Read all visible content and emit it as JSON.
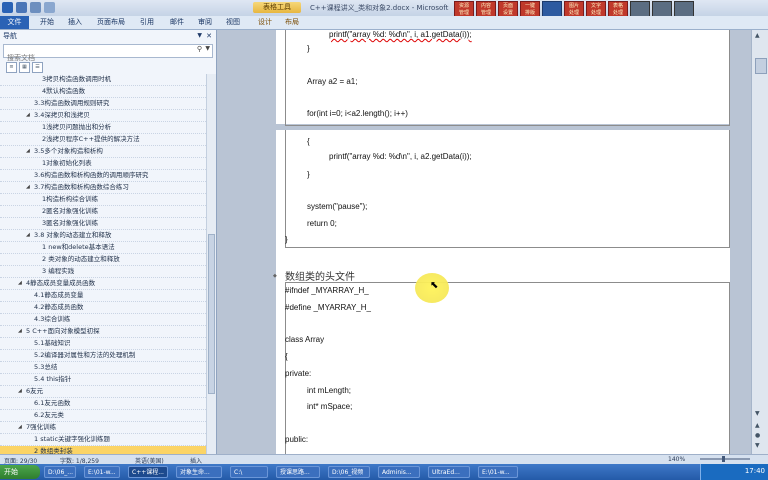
{
  "app": {
    "context_tab": "表格工具",
    "doc_title": "C++课程讲义_类和对象2.docx - Microsoft"
  },
  "ribbon_tabs": [
    "文件",
    "开始",
    "插入",
    "页面布局",
    "引用",
    "邮件",
    "审阅",
    "视图",
    "设计",
    "布局"
  ],
  "toolbar_icons": [
    {
      "label": "资源\n管理",
      "icon": "toolbar-icon-1"
    },
    {
      "label": "内容\n管理",
      "icon": "toolbar-icon-2"
    },
    {
      "label": "页面\n设置",
      "icon": "toolbar-icon-3"
    },
    {
      "label": "一键\n排版",
      "icon": "toolbar-icon-4"
    },
    {
      "label": "",
      "icon": "system-icon-1"
    },
    {
      "label": "图片\n处理",
      "icon": "toolbar-icon-5"
    },
    {
      "label": "文字\n处理",
      "icon": "toolbar-icon-6"
    },
    {
      "label": "表格\n处理",
      "icon": "toolbar-icon-7"
    },
    {
      "label": "",
      "icon": "system-icon-2"
    },
    {
      "label": "",
      "icon": "system-icon-3"
    },
    {
      "label": "",
      "icon": "system-icon-4"
    }
  ],
  "nav": {
    "title": "导航",
    "search_placeholder": "搜索文档",
    "items": [
      {
        "text": "3拷贝构造函数调用时机",
        "indent": 4,
        "toggle": ""
      },
      {
        "text": "4默认构造函数",
        "indent": 4,
        "toggle": ""
      },
      {
        "text": "3.3构造函数调用规则研究",
        "indent": 3,
        "toggle": ""
      },
      {
        "text": "3.4深拷贝和浅拷贝",
        "indent": 3,
        "toggle": "◢"
      },
      {
        "text": "1浅拷贝问题抛出和分析",
        "indent": 4,
        "toggle": ""
      },
      {
        "text": "2浅拷贝程序C++提供的解决方法",
        "indent": 4,
        "toggle": ""
      },
      {
        "text": "3.5多个对象构造和析构",
        "indent": 3,
        "toggle": "◢"
      },
      {
        "text": "1对象初始化列表",
        "indent": 4,
        "toggle": ""
      },
      {
        "text": "3.6构造函数和析构函数的调用顺序研究",
        "indent": 3,
        "toggle": ""
      },
      {
        "text": "3.7构造函数和析构函数综合练习",
        "indent": 3,
        "toggle": "◢"
      },
      {
        "text": "1构造析构综合训练",
        "indent": 4,
        "toggle": ""
      },
      {
        "text": "2匿名对象强化训练",
        "indent": 4,
        "toggle": ""
      },
      {
        "text": "3匿名对象强化训练",
        "indent": 4,
        "toggle": ""
      },
      {
        "text": "3.8 对象的动态建立和释放",
        "indent": 3,
        "toggle": "◢"
      },
      {
        "text": "1 new和delete基本语法",
        "indent": 4,
        "toggle": ""
      },
      {
        "text": "2 类对象的动态建立和释放",
        "indent": 4,
        "toggle": ""
      },
      {
        "text": "3 编程实践",
        "indent": 4,
        "toggle": ""
      },
      {
        "text": "4静态成员变量成员函数",
        "indent": 2,
        "toggle": "◢"
      },
      {
        "text": "4.1静态成员变量",
        "indent": 3,
        "toggle": ""
      },
      {
        "text": "4.2静态成员函数",
        "indent": 3,
        "toggle": ""
      },
      {
        "text": "4.3综合训练",
        "indent": 3,
        "toggle": ""
      },
      {
        "text": "5 C++面向对象模型初探",
        "indent": 2,
        "toggle": "◢"
      },
      {
        "text": "5.1基础知识",
        "indent": 3,
        "toggle": ""
      },
      {
        "text": "5.2编译器对属性和方法的处理机制",
        "indent": 3,
        "toggle": ""
      },
      {
        "text": "5.3总结",
        "indent": 3,
        "toggle": ""
      },
      {
        "text": "5.4 this指针",
        "indent": 3,
        "toggle": ""
      },
      {
        "text": "6友元",
        "indent": 2,
        "toggle": "◢"
      },
      {
        "text": "6.1友元函数",
        "indent": 3,
        "toggle": ""
      },
      {
        "text": "6.2友元类",
        "indent": 3,
        "toggle": ""
      },
      {
        "text": "7强化训练",
        "indent": 2,
        "toggle": "◢"
      },
      {
        "text": "1 static关键字强化训练题",
        "indent": 3,
        "toggle": ""
      },
      {
        "text": "2 数组类封装",
        "indent": 3,
        "toggle": "",
        "selected": true
      }
    ]
  },
  "document": {
    "page1_lines": [
      "printf(\"array %d: %d\\n\", i, a1.getData(i));",
      "}",
      "Array a2 = a1;",
      "for(int i=0; i<a2.length(); i++)"
    ],
    "page2_block1": [
      "{",
      "printf(\"array %d: %d\\n\", i, a2.getData(i));",
      "}",
      "system(\"pause\");",
      "return 0;",
      "}"
    ],
    "heading": "数组类的头文件",
    "page2_block2": [
      "#ifndef _MYARRAY_H_",
      "#define _MYARRAY_H_",
      "class Array",
      "{",
      "private:",
      "int mLength;",
      "int* mSpace;",
      "public:"
    ]
  },
  "status": {
    "page": "页面: 29/30",
    "words": "字数: 1/8,259",
    "lang": "英语(美国)",
    "mode": "插入",
    "zoom": "140%"
  },
  "taskbar": {
    "start": "开始",
    "buttons": [
      "D:\\06_...",
      "E:\\01-w...",
      "C++课程...",
      "对象生命...",
      "C:\\",
      "授课思路...",
      "D:\\06_视频",
      "Adminis...",
      "UltraEd...",
      "E:\\01-w..."
    ],
    "clock": "17:40"
  }
}
